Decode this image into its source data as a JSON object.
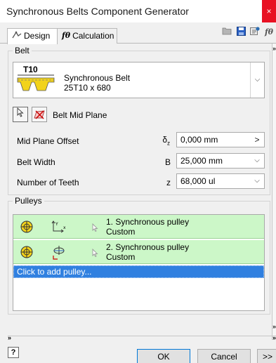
{
  "window": {
    "title": "Synchronous Belts Component Generator",
    "close_glyph": "×"
  },
  "tabs": [
    {
      "label": "Design",
      "icon": "design-icon"
    },
    {
      "label": "Calculation",
      "icon": "fx-icon",
      "icon_text": "fθ"
    }
  ],
  "toolbar": {
    "fx_text": "fθ"
  },
  "belt": {
    "legend": "Belt",
    "image_text": "T10",
    "name": "Synchronous Belt",
    "size": "25T10 x 680",
    "mid_plane_label": "Belt Mid Plane",
    "rows": [
      {
        "label": "Mid Plane Offset",
        "symbol": "δ",
        "symbol_sub": "z",
        "value": "0,000 mm",
        "button": ">"
      },
      {
        "label": "Belt Width",
        "symbol": "B",
        "value": "25,000 mm",
        "button": "⌵"
      },
      {
        "label": "Number of Teeth",
        "symbol": "z",
        "value": "68,000 ul",
        "button": "⌵"
      }
    ]
  },
  "pulleys": {
    "legend": "Pulleys",
    "items": [
      {
        "line1": "1. Synchronous pulley",
        "line2": "Custom"
      },
      {
        "line1": "2. Synchronous pulley",
        "line2": "Custom"
      }
    ],
    "add_label": "Click to add pulley..."
  },
  "footer": {
    "help_glyph": "?",
    "ok_label": "OK",
    "cancel_label": "Cancel",
    "more_label": ">>"
  },
  "colors": {
    "pulley_row_bg": "#ccf7c8",
    "selected_row_bg": "#3080e0",
    "close_button": "#e81123"
  }
}
